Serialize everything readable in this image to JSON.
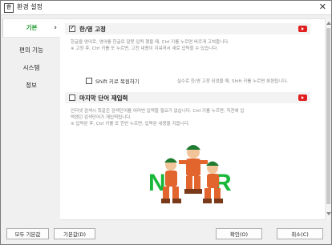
{
  "window": {
    "title": "환경 설정",
    "app_icon_text": "한",
    "close_icon": "close-icon"
  },
  "sidebar": {
    "items": [
      {
        "label": "기본",
        "active": true
      },
      {
        "label": "편의 기능",
        "active": false
      },
      {
        "label": "시스템",
        "active": false
      },
      {
        "label": "정보",
        "active": false
      }
    ]
  },
  "section1": {
    "title": "한/영 고정",
    "checked": true,
    "desc_lines": [
      "한글을 영어로, 영어를 한글로 잘못 입력 했을 때, Ctrl 키를 누르면 바르게 고쳐줍니다.",
      "※ 고정 후, Ctrl 키를 또 누르면, 고친 내용이 지워져서 새로 입력할 수 있습니다."
    ],
    "shift_option": {
      "label": "Shift 키로 복원하기",
      "checked": false,
      "desc": "실수로 한/영 고정 되었을 때, Shift 키를 누르면 복원됩니다."
    }
  },
  "section2": {
    "title": "마지막 단어 재입력",
    "checked": false,
    "desc_lines": [
      "인터넷 검색시 똑같은 검색단어를 여러번 입력할 필요가 없습니다.  Ctrl 키를 누르면, 직전에 입",
      "력했던 검색단어가 재입력됩니다.",
      "※ 입력된 후, Ctrl 키를 또 한번 누르면, 입력된 내용을 지웁니다."
    ]
  },
  "buttons": {
    "reset_all": "모두 기본값",
    "reset": "기본값(D)",
    "ok": "확인(O)",
    "cancel": "취소(C)"
  },
  "colors": {
    "accent_green": "#1a9a2a",
    "youtube_red": "#e02020",
    "naver_green": "#19b83a"
  }
}
